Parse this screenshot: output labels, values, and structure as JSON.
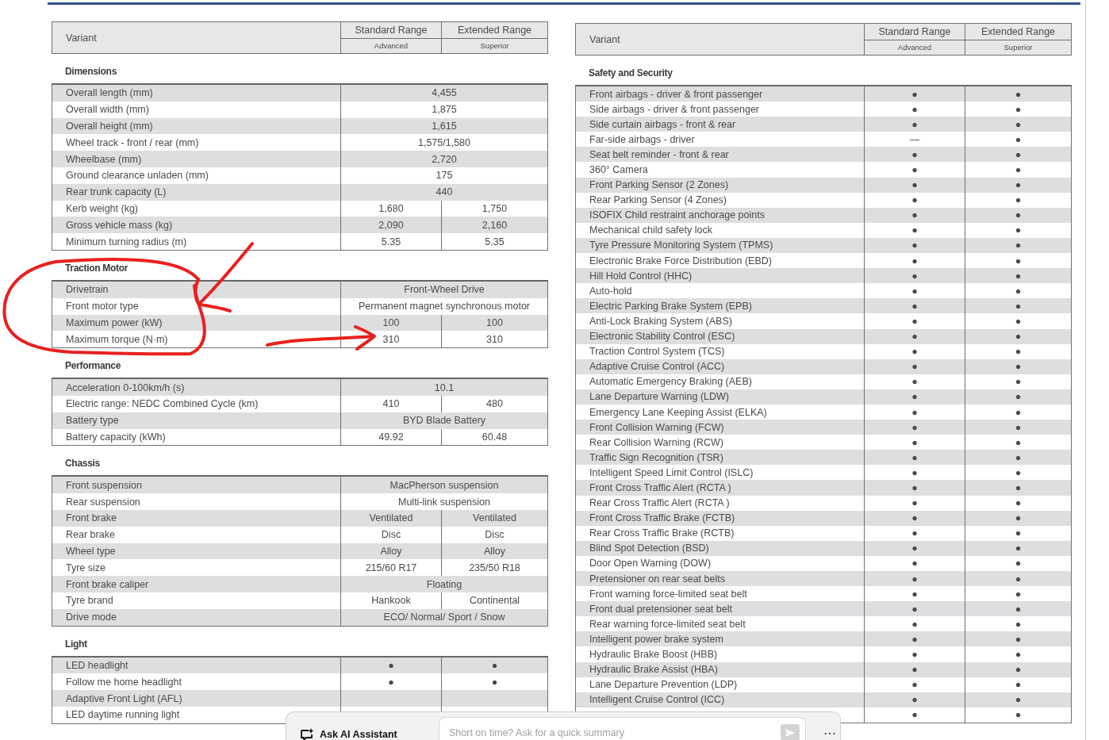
{
  "left": {
    "header": {
      "label": "Variant",
      "columns": [
        {
          "name": "Standard Range",
          "sub": "Advanced"
        },
        {
          "name": "Extended Range",
          "sub": "Superior"
        }
      ]
    },
    "sections": [
      {
        "title": "Dimensions",
        "rows": [
          {
            "label": "Overall length (mm)",
            "values": [
              "4,455"
            ]
          },
          {
            "label": "Overall width (mm)",
            "values": [
              "1,875"
            ]
          },
          {
            "label": "Overall height (mm)",
            "values": [
              "1,615"
            ]
          },
          {
            "label": "Wheel track - front / rear (mm)",
            "values": [
              "1,575/1,580"
            ]
          },
          {
            "label": "Wheelbase (mm)",
            "values": [
              "2,720"
            ]
          },
          {
            "label": "Ground clearance unladen (mm)",
            "values": [
              "175"
            ]
          },
          {
            "label": "Rear trunk capacity (L)",
            "values": [
              "440"
            ]
          },
          {
            "label": "Kerb weight (kg)",
            "values": [
              "1,680",
              "1,750"
            ]
          },
          {
            "label": "Gross vehicle mass (kg)",
            "values": [
              "2,090",
              "2,160"
            ]
          },
          {
            "label": "Minimum turning radius (m)",
            "values": [
              "5.35",
              "5.35"
            ]
          }
        ]
      },
      {
        "title": "Traction Motor",
        "rows": [
          {
            "label": "Drivetrain",
            "values": [
              "Front-Wheel Drive"
            ]
          },
          {
            "label": "Front motor type",
            "values": [
              "Permanent magnet synchronous motor"
            ]
          },
          {
            "label": "Maximum power (kW)",
            "values": [
              "100",
              "100"
            ]
          },
          {
            "label": "Maximum torque (N·m)",
            "values": [
              "310",
              "310"
            ]
          }
        ]
      },
      {
        "title": "Performance",
        "rows": [
          {
            "label": "Acceleration 0-100km/h (s)",
            "values": [
              "10.1"
            ]
          },
          {
            "label": "Electric range: NEDC Combined Cycle (km)",
            "values": [
              "410",
              "480"
            ]
          },
          {
            "label": "Battery type",
            "values": [
              "BYD Blade Battery"
            ]
          },
          {
            "label": "Battery capacity (kWh)",
            "values": [
              "49.92",
              "60.48"
            ]
          }
        ]
      },
      {
        "title": "Chassis",
        "rows": [
          {
            "label": "Front suspension",
            "values": [
              "MacPherson suspension"
            ]
          },
          {
            "label": "Rear suspension",
            "values": [
              "Multi-link suspension"
            ]
          },
          {
            "label": "Front brake",
            "values": [
              "Ventilated",
              "Ventilated"
            ]
          },
          {
            "label": "Rear brake",
            "values": [
              "Disc",
              "Disc"
            ]
          },
          {
            "label": "Wheel type",
            "values": [
              "Alloy",
              "Alloy"
            ]
          },
          {
            "label": "Tyre size",
            "values": [
              "215/60 R17",
              "235/50 R18"
            ]
          },
          {
            "label": "Front brake caliper",
            "values": [
              "Floating"
            ]
          },
          {
            "label": "Tyre brand",
            "values": [
              "Hankook",
              "Continental"
            ]
          },
          {
            "label": "Drive mode",
            "values": [
              "ECO/ Normal/ Sport / Snow"
            ]
          }
        ]
      },
      {
        "title": "Light",
        "rows": [
          {
            "label": "LED headlight",
            "values": [
              "●",
              "●"
            ]
          },
          {
            "label": "Follow me home headlight",
            "values": [
              "●",
              "●"
            ]
          },
          {
            "label": "Adaptive Front Light (AFL)"
          },
          {
            "label": "LED daytime running light"
          }
        ]
      }
    ]
  },
  "right": {
    "header": {
      "label": "Variant",
      "columns": [
        {
          "name": "Standard Range",
          "sub": "Advanced"
        },
        {
          "name": "Extended Range",
          "sub": "Superior"
        }
      ]
    },
    "sections": [
      {
        "title": "Safety and Security",
        "rows": [
          {
            "label": "Front airbags - driver & front passenger",
            "values": [
              "●",
              "●"
            ]
          },
          {
            "label": "Side airbags - driver & front passenger",
            "values": [
              "●",
              "●"
            ]
          },
          {
            "label": "Side curtain airbags - front & rear",
            "values": [
              "●",
              "●"
            ]
          },
          {
            "label": "Far-side airbags - driver",
            "values": [
              "—",
              "●"
            ]
          },
          {
            "label": "Seat belt reminder - front & rear",
            "values": [
              "●",
              "●"
            ]
          },
          {
            "label": "360° Camera",
            "values": [
              "●",
              "●"
            ]
          },
          {
            "label": "Front Parking Sensor (2 Zones)",
            "values": [
              "●",
              "●"
            ]
          },
          {
            "label": "Rear Parking Sensor (4 Zones)",
            "values": [
              "●",
              "●"
            ]
          },
          {
            "label": "ISOFIX Child restraint anchorage points",
            "values": [
              "●",
              "●"
            ]
          },
          {
            "label": "Mechanical child safety lock",
            "values": [
              "●",
              "●"
            ]
          },
          {
            "label": "Tyre Pressure Monitoring System (TPMS)",
            "values": [
              "●",
              "●"
            ]
          },
          {
            "label": "Electronic Brake Force Distribution (EBD)",
            "values": [
              "●",
              "●"
            ]
          },
          {
            "label": "Hill Hold Control (HHC)",
            "values": [
              "●",
              "●"
            ]
          },
          {
            "label": "Auto-hold",
            "values": [
              "●",
              "●"
            ]
          },
          {
            "label": "Electric Parking Brake System (EPB)",
            "values": [
              "●",
              "●"
            ]
          },
          {
            "label": "Anti-Lock Braking System (ABS)",
            "values": [
              "●",
              "●"
            ]
          },
          {
            "label": "Electronic Stability Control (ESC)",
            "values": [
              "●",
              "●"
            ]
          },
          {
            "label": "Traction Control System (TCS)",
            "values": [
              "●",
              "●"
            ]
          },
          {
            "label": "Adaptive Cruise Control (ACC)",
            "values": [
              "●",
              "●"
            ]
          },
          {
            "label": "Automatic Emergency Braking (AEB)",
            "values": [
              "●",
              "●"
            ]
          },
          {
            "label": "Lane Departure Warning (LDW)",
            "values": [
              "●",
              "●"
            ]
          },
          {
            "label": "Emergency Lane Keeping Assist (ELKA)",
            "values": [
              "●",
              "●"
            ]
          },
          {
            "label": "Front Collision Warning (FCW)",
            "values": [
              "●",
              "●"
            ]
          },
          {
            "label": "Rear Collision Warning (RCW)",
            "values": [
              "●",
              "●"
            ]
          },
          {
            "label": "Traffic Sign Recognition (TSR)",
            "values": [
              "●",
              "●"
            ]
          },
          {
            "label": "Intelligent Speed Limit Control (ISLC)",
            "values": [
              "●",
              "●"
            ]
          },
          {
            "label": "Front Cross Traffic Alert (RCTA )",
            "values": [
              "●",
              "●"
            ]
          },
          {
            "label": "Rear Cross Traffic Alert (RCTA )",
            "values": [
              "●",
              "●"
            ]
          },
          {
            "label": "Front Cross Traffic Brake (FCTB)",
            "values": [
              "●",
              "●"
            ]
          },
          {
            "label": "Rear Cross Traffic Brake (RCTB)",
            "values": [
              "●",
              "●"
            ]
          },
          {
            "label": "Blind Spot Detection (BSD)",
            "values": [
              "●",
              "●"
            ]
          },
          {
            "label": "Door Open Warning (DOW)",
            "values": [
              "●",
              "●"
            ]
          },
          {
            "label": "Pretensioner on rear seat belts",
            "values": [
              "●",
              "●"
            ]
          },
          {
            "label": "Front warning force-limited seat belt",
            "values": [
              "●",
              "●"
            ]
          },
          {
            "label": "Front dual pretensioner seat belt",
            "values": [
              "●",
              "●"
            ]
          },
          {
            "label": "Rear warning force-limited seat belt",
            "values": [
              "●",
              "●"
            ]
          },
          {
            "label": "Intelligent power brake system",
            "values": [
              "●",
              "●"
            ]
          },
          {
            "label": "Hydraulic Brake Boost (HBB)",
            "values": [
              "●",
              "●"
            ]
          },
          {
            "label": "Hydraulic Brake Assist (HBA)",
            "values": [
              "●",
              "●"
            ]
          },
          {
            "label": "Lane Departure Prevention (LDP)",
            "values": [
              "●",
              "●"
            ]
          },
          {
            "label": "Intelligent Cruise Control (ICC)",
            "values": [
              "●",
              "●"
            ]
          },
          {
            "values": [
              "●",
              "●"
            ]
          }
        ]
      }
    ]
  },
  "assistant": {
    "title": "Ask AI Assistant",
    "placeholder": "Short on time? Ask for a quick summary",
    "more": "⋯"
  }
}
